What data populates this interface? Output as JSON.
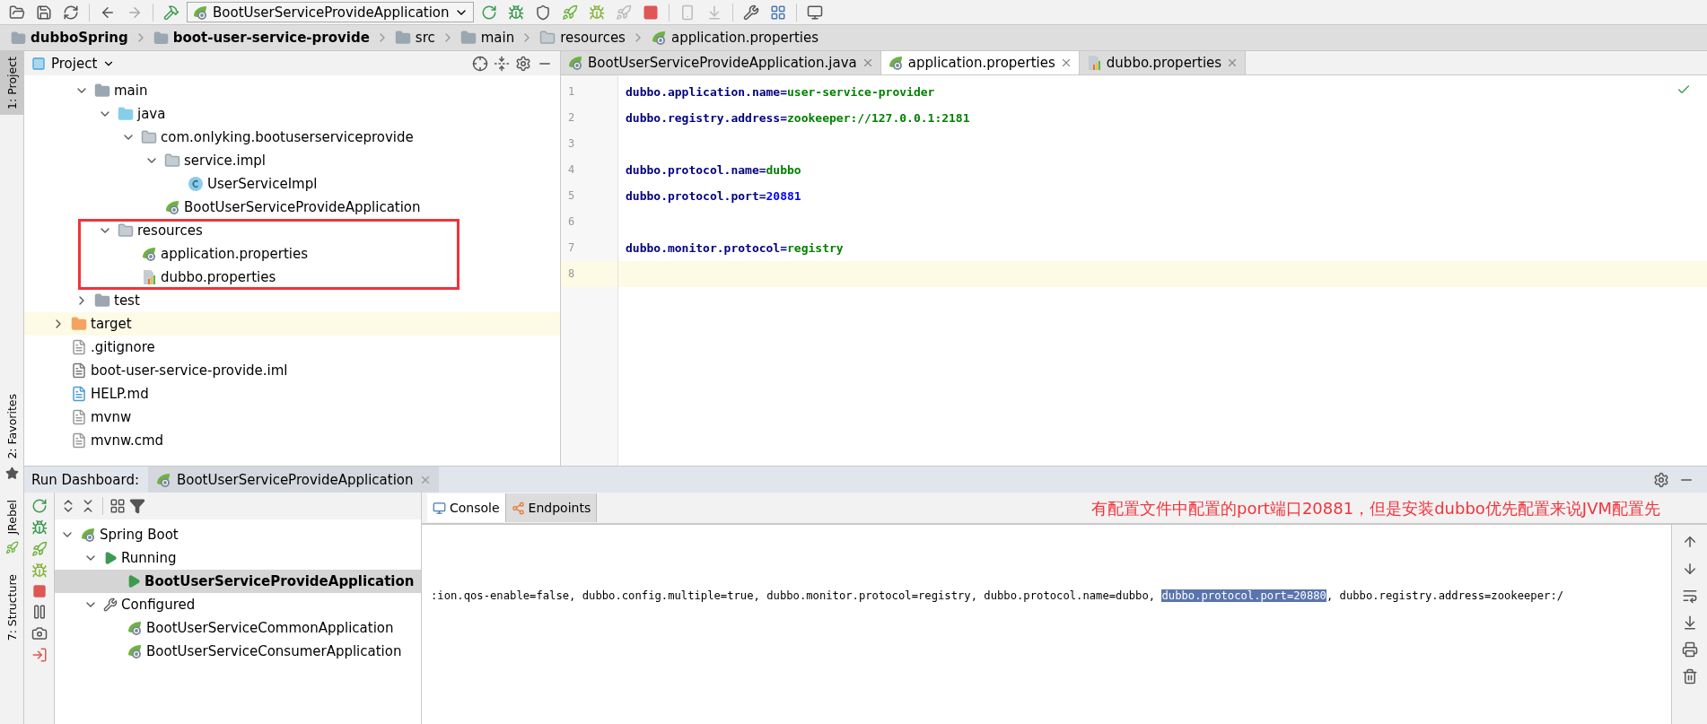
{
  "toolbar": {
    "run_configuration": "BootUserServiceProvideApplication"
  },
  "breadcrumbs": [
    {
      "label": "dubboSpring",
      "kind": "module",
      "bold": true
    },
    {
      "label": "boot-user-service-provide",
      "kind": "module",
      "bold": true
    },
    {
      "label": "src",
      "kind": "folder",
      "bold": false
    },
    {
      "label": "main",
      "kind": "folder",
      "bold": false
    },
    {
      "label": "resources",
      "kind": "resources",
      "bold": false
    },
    {
      "label": "application.properties",
      "kind": "spring",
      "bold": false
    }
  ],
  "left_stripe": [
    {
      "label": "1: Project",
      "selected": true
    },
    {
      "label": "2: Favorites",
      "selected": false
    },
    {
      "label": "JRebel",
      "selected": false
    },
    {
      "label": "7: Structure",
      "selected": false
    }
  ],
  "project_panel": {
    "title": "Project",
    "tree": [
      {
        "kind": "scrolled_parent",
        "children": [
          {
            "label": "main",
            "kind": "folder",
            "expanded": true,
            "highlighted": false,
            "children": [
              {
                "label": "java",
                "kind": "source",
                "expanded": true,
                "highlighted": false,
                "children": [
                  {
                    "label": "com.onlyking.bootuserserviceprovide",
                    "kind": "package",
                    "expanded": true,
                    "highlighted": false,
                    "children": [
                      {
                        "label": "service.impl",
                        "kind": "package",
                        "expanded": true,
                        "highlighted": false,
                        "children": [
                          {
                            "label": "UserServiceImpl",
                            "kind": "class",
                            "highlighted": false
                          }
                        ]
                      },
                      {
                        "label": "BootUserServiceProvideApplication",
                        "kind": "spring",
                        "highlighted": false
                      }
                    ]
                  }
                ]
              },
              {
                "label": "resources",
                "kind": "resources",
                "expanded": true,
                "highlighted": false,
                "children": [
                  {
                    "label": "application.properties",
                    "kind": "spring",
                    "highlighted": false
                  },
                  {
                    "label": "dubbo.properties",
                    "kind": "properties",
                    "highlighted": false
                  }
                ]
              }
            ]
          },
          {
            "label": "test",
            "kind": "folder",
            "expanded": false,
            "highlighted": false
          }
        ]
      },
      {
        "label": "target",
        "kind": "excluded",
        "expanded": false,
        "highlighted": true
      },
      {
        "label": ".gitignore",
        "kind": "file",
        "highlighted": false
      },
      {
        "label": "boot-user-service-provide.iml",
        "kind": "iml",
        "highlighted": false
      },
      {
        "label": "HELP.md",
        "kind": "md",
        "highlighted": false
      },
      {
        "label": "mvnw",
        "kind": "file",
        "highlighted": false
      },
      {
        "label": "mvnw.cmd",
        "kind": "file",
        "highlighted": false
      }
    ]
  },
  "editor": {
    "tabs": [
      {
        "label": "BootUserServiceProvideApplication.java",
        "kind": "spring",
        "selected": false
      },
      {
        "label": "application.properties",
        "kind": "spring",
        "selected": true
      },
      {
        "label": "dubbo.properties",
        "kind": "properties",
        "selected": false
      }
    ],
    "lines": [
      {
        "number": "1",
        "key": "dubbo.application.name=",
        "value": "user-service-provider",
        "kind": "string",
        "current": false
      },
      {
        "number": "2",
        "key": "dubbo.registry.address=",
        "value": "zookeeper://127.0.0.1:2181",
        "kind": "string",
        "current": false
      },
      {
        "number": "3",
        "kind": "blank",
        "current": false
      },
      {
        "number": "4",
        "key": "dubbo.protocol.name=",
        "value": "dubbo",
        "kind": "string",
        "current": false
      },
      {
        "number": "5",
        "key": "dubbo.protocol.port=",
        "value": "20881",
        "kind": "number",
        "current": false
      },
      {
        "number": "6",
        "kind": "blank",
        "current": false
      },
      {
        "number": "7",
        "key": "dubbo.monitor.protocol=",
        "value": "registry",
        "kind": "string",
        "current": false
      },
      {
        "number": "8",
        "kind": "blank",
        "current": true
      }
    ]
  },
  "run_dashboard": {
    "title": "Run Dashboard:",
    "tab": "BootUserServiceProvideApplication",
    "tree": [
      {
        "label": "Spring Boot",
        "kind": "spring",
        "expanded": true,
        "selected": false,
        "children": [
          {
            "label": "Running",
            "kind": "running",
            "expanded": true,
            "selected": false,
            "children": [
              {
                "label": "BootUserServiceProvideApplication",
                "kind": "running",
                "selected": true
              }
            ]
          },
          {
            "label": "Configured",
            "kind": "wrench",
            "expanded": true,
            "selected": false,
            "children": [
              {
                "label": "BootUserServiceCommonApplication",
                "kind": "spring",
                "selected": false
              },
              {
                "label": "BootUserServiceConsumerApplication",
                "kind": "spring",
                "selected": false
              }
            ]
          }
        ]
      }
    ],
    "console_tabs": [
      {
        "label": "Console",
        "kind": "console",
        "selected": true
      },
      {
        "label": "Endpoints",
        "kind": "endpoints",
        "selected": false
      }
    ],
    "annotation": "有配置文件中配置的port端口20881，但是安装dubbo优先配置来说JVM配置先",
    "console_line": [
      {
        "text": ":ion.qos-enable=false, dubbo.config.multiple=true, dubbo.monitor.protocol=registry, dubbo.protocol.name=dubbo, ",
        "selected": false
      },
      {
        "text": "dubbo.protocol.port=20880",
        "selected": true
      },
      {
        "text": ", dubbo.registry.address=zookeeper:/",
        "selected": false
      }
    ]
  }
}
